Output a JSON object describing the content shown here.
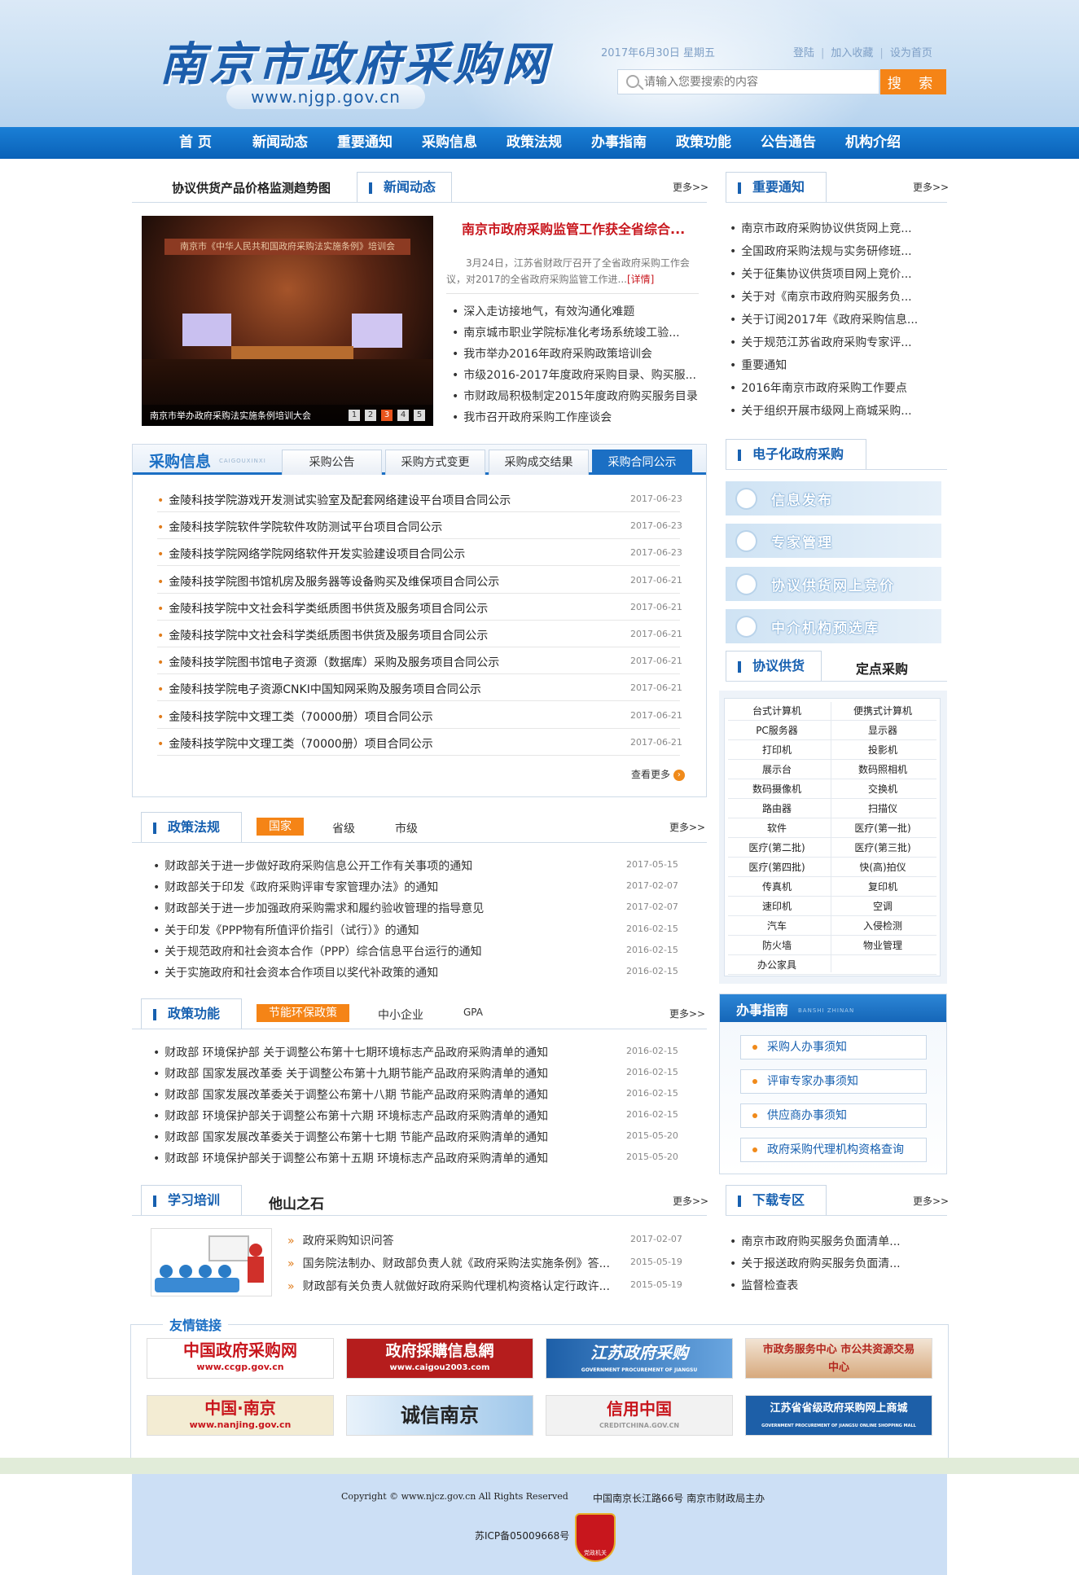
{
  "header": {
    "logo_title": "南京市政府采购网",
    "logo_url": "www.njgp.gov.cn",
    "date": "2017年6月30日 星期五",
    "top_links": [
      "登陆",
      "加入收藏",
      "设为首页"
    ],
    "search_placeholder": "请输入您要搜索的内容",
    "search_button": "搜 索"
  },
  "nav": [
    "首 页",
    "新闻动态",
    "重要通知",
    "采购信息",
    "政策法规",
    "办事指南",
    "政策功能",
    "公告通告",
    "机构介绍"
  ],
  "news": {
    "tab_inactive": "协议供货产品价格监测趋势图",
    "tab_active": "新闻动态",
    "more": "更多>>",
    "photo_banner": "南京市《中华人民共和国政府采购法实施条例》培训会",
    "photo_caption": "南京市举办政府采购法实施条例培训大会",
    "pages": [
      "1",
      "2",
      "3",
      "4",
      "5"
    ],
    "headline": "南京市政府采购监管工作获全省综合...",
    "summary": "3月24日，江苏省财政厅召开了全省政府采购工作会议，对2017的全省政府采购监管工作进...",
    "detail": "[详情]",
    "items": [
      "深入走访接地气，有效沟通化难题",
      "南京城市职业学院标准化考场系统竣工验...",
      "我市举办2016年政府采购政策培训会",
      "市级2016-2017年度政府采购目录、购买服...",
      "市财政局积极制定2015年度政府购买服务目录",
      "我市召开政府采购工作座谈会"
    ]
  },
  "notice": {
    "title": "重要通知",
    "more": "更多>>",
    "items": [
      "南京市政府采购协议供货网上竞...",
      "全国政府采购法规与实务研修班...",
      "关于征集协议供货项目网上竞价...",
      "关于对《南京市政府购买服务负...",
      "关于订阅2017年《政府采购信息...",
      "关于规范江苏省政府采购专家评...",
      "重要通知",
      "2016年南京市政府采购工作要点",
      "关于组织开展市级网上商城采购..."
    ]
  },
  "procurement": {
    "title": "采购信息",
    "title_en": "CAIGOUXINXI",
    "tabs": [
      "采购公告",
      "采购方式变更",
      "采购成交结果",
      "采购合同公示"
    ],
    "more": "查看更多",
    "rows": [
      {
        "title": "金陵科技学院游戏开发测试实验室及配套网络建设平台项目合同公示",
        "date": "2017-06-23"
      },
      {
        "title": "金陵科技学院软件学院软件攻防测试平台项目合同公示",
        "date": "2017-06-23"
      },
      {
        "title": "金陵科技学院网络学院网络软件开发实验建设项目合同公示",
        "date": "2017-06-23"
      },
      {
        "title": "金陵科技学院图书馆机房及服务器等设备购买及维保项目合同公示",
        "date": "2017-06-21"
      },
      {
        "title": "金陵科技学院中文社会科学类纸质图书供货及服务项目合同公示",
        "date": "2017-06-21"
      },
      {
        "title": "金陵科技学院中文社会科学类纸质图书供货及服务项目合同公示",
        "date": "2017-06-21"
      },
      {
        "title": "金陵科技学院图书馆电子资源（数据库）采购及服务项目合同公示",
        "date": "2017-06-21"
      },
      {
        "title": "金陵科技学院电子资源CNKI中国知网采购及服务项目合同公示",
        "date": "2017-06-21"
      },
      {
        "title": "金陵科技学院中文理工类（70000册）项目合同公示",
        "date": "2017-06-21"
      },
      {
        "title": "金陵科技学院中文理工类（70000册）项目合同公示",
        "date": "2017-06-21"
      }
    ]
  },
  "policy": {
    "title": "政策法规",
    "subtabs": [
      "国家",
      "省级",
      "市级"
    ],
    "more": "更多>>",
    "rows": [
      {
        "title": "财政部关于进一步做好政府采购信息公开工作有关事项的通知",
        "date": "2017-05-15"
      },
      {
        "title": "财政部关于印发《政府采购评审专家管理办法》的通知",
        "date": "2017-02-07"
      },
      {
        "title": "财政部关于进一步加强政府采购需求和履约验收管理的指导意见",
        "date": "2017-02-07"
      },
      {
        "title": "关于印发《PPP物有所值评价指引（试行）》的通知",
        "date": "2016-02-15"
      },
      {
        "title": "关于规范政府和社会资本合作（PPP）综合信息平台运行的通知",
        "date": "2016-02-15"
      },
      {
        "title": "关于实施政府和社会资本合作项目以奖代补政策的通知",
        "date": "2016-02-15"
      }
    ]
  },
  "function": {
    "title": "政策功能",
    "subtabs": [
      "节能环保政策",
      "中小企业",
      "GPA"
    ],
    "more": "更多>>",
    "rows": [
      {
        "title": "财政部 环境保护部 关于调整公布第十七期环境标志产品政府采购清单的通知",
        "date": "2016-02-15"
      },
      {
        "title": "财政部 国家发展改革委 关于调整公布第十九期节能产品政府采购清单的通知",
        "date": "2016-02-15"
      },
      {
        "title": "财政部 国家发展改革委关于调整公布第十八期 节能产品政府采购清单的通知",
        "date": "2016-02-15"
      },
      {
        "title": "财政部 环境保护部关于调整公布第十六期 环境标志产品政府采购清单的通知",
        "date": "2016-02-15"
      },
      {
        "title": "财政部 国家发展改革委关于调整公布第十七期 节能产品政府采购清单的通知",
        "date": "2015-05-20"
      },
      {
        "title": "财政部 环境保护部关于调整公布第十五期 环境标志产品政府采购清单的通知",
        "date": "2015-05-20"
      }
    ]
  },
  "training": {
    "title": "学习培训",
    "other_tab": "他山之石",
    "more": "更多>>",
    "rows": [
      {
        "title": "政府采购知识问答",
        "date": "2017-02-07"
      },
      {
        "title": "国务院法制办、财政部负责人就《政府采购法实施条例》答...",
        "date": "2015-05-19"
      },
      {
        "title": "财政部有关负责人就做好政府采购代理机构资格认定行政许...",
        "date": "2015-05-19"
      }
    ]
  },
  "download": {
    "title": "下载专区",
    "more": "更多>>",
    "items": [
      "南京市政府购买服务负面清单...",
      "关于报送政府购买服务负面清...",
      "监督检查表"
    ]
  },
  "e_procurement": {
    "title": "电子化政府采购",
    "blocks": [
      "信息发布",
      "专家管理",
      "协议供货网上竞价",
      "中介机构预选库"
    ]
  },
  "supply": {
    "tab_active": "协议供货",
    "tab_other": "定点采购",
    "cells": [
      [
        "台式计算机",
        "便携式计算机"
      ],
      [
        "PC服务器",
        "显示器"
      ],
      [
        "打印机",
        "投影机"
      ],
      [
        "展示台",
        "数码照相机"
      ],
      [
        "数码摄像机",
        "交换机"
      ],
      [
        "路由器",
        "扫描仪"
      ],
      [
        "软件",
        "医疗(第一批)"
      ],
      [
        "医疗(第二批)",
        "医疗(第三批)"
      ],
      [
        "医疗(第四批)",
        "快(高)拍仪"
      ],
      [
        "传真机",
        "复印机"
      ],
      [
        "速印机",
        "空调"
      ],
      [
        "汽车",
        "入侵检测"
      ],
      [
        "防火墙",
        "物业管理"
      ],
      [
        "办公家具",
        ""
      ]
    ]
  },
  "guide": {
    "title": "办事指南",
    "title_en": "BANSHI ZHINAN",
    "buttons": [
      "采购人办事须知",
      "评审专家办事须知",
      "供应商办事须知",
      "政府采购代理机构资格查询"
    ]
  },
  "links": {
    "title": "友情链接",
    "items": [
      {
        "label": "中国政府采购网",
        "sub": "www.ccgp.gov.cn"
      },
      {
        "label": "政府採購信息網",
        "sub": "www.caigou2003.com"
      },
      {
        "label": "江苏政府采购",
        "sub": "GOVERNMENT PROCUREMENT OF JIANGSU"
      },
      {
        "label": "市政务服务中心 市公共资源交易中心",
        "sub": ""
      },
      {
        "label": "中国·南京",
        "sub": "www.nanjing.gov.cn"
      },
      {
        "label": "诚信南京",
        "sub": ""
      },
      {
        "label": "信用中国",
        "sub": "CREDITCHINA.GOV.CN"
      },
      {
        "label": "江苏省省级政府采购网上商城",
        "sub": "GOVERNMENT PROCUREMENT OF JIANGSU ONLINE SHOPPING MALL"
      }
    ]
  },
  "footer": {
    "copyright": "Copyright © www.njcz.gov.cn All Rights Reserved",
    "address": "中国南京长江路66号 南京市财政局主办",
    "icp": "苏ICP备05009668号",
    "badge": "党政机关"
  },
  "colors": {
    "nav_blue": "#0a62b8",
    "accent_orange": "#f58416",
    "link_blue": "#1760b0",
    "headline_red": "#c8161d"
  }
}
